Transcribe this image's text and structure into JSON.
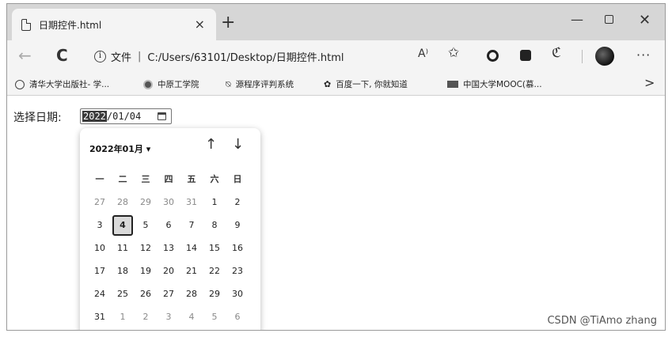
{
  "tab": {
    "title": "日期控件.html",
    "close": "×",
    "new_tab": "+"
  },
  "window_controls": {
    "minimize": "—",
    "close": "✕"
  },
  "toolbar": {
    "back": "←",
    "reload": "C",
    "file_label": "文件",
    "separator": "|",
    "url": "C:/Users/63101/Desktop/日期控件.html",
    "read_aloud": "A⁾",
    "favorite": "✩",
    "more": "···"
  },
  "bookmarks": [
    {
      "label": "清华大学出版社- 学...",
      "icon": "circle-icon"
    },
    {
      "label": "中原工学院",
      "icon": "dot-icon"
    },
    {
      "label": "源程序评判系统",
      "icon": "clip-icon"
    },
    {
      "label": "百度一下, 你就知道",
      "icon": "paw-icon"
    },
    {
      "label": "中国大学MOOC(慕...",
      "icon": "book-icon"
    }
  ],
  "bookmarks_more": ">",
  "form": {
    "label": "选择日期:",
    "value_year": "2022",
    "value_rest": "/01/04"
  },
  "calendar": {
    "month_label": "2022年01月 ▾",
    "nav_up": "↑",
    "nav_down": "↓",
    "weekdays": [
      "一",
      "二",
      "三",
      "四",
      "五",
      "六",
      "日"
    ],
    "weeks": [
      [
        "27",
        "28",
        "29",
        "30",
        "31",
        "1",
        "2"
      ],
      [
        "3",
        "4",
        "5",
        "6",
        "7",
        "8",
        "9"
      ],
      [
        "10",
        "11",
        "12",
        "13",
        "14",
        "15",
        "16"
      ],
      [
        "17",
        "18",
        "19",
        "20",
        "21",
        "22",
        "23"
      ],
      [
        "24",
        "25",
        "26",
        "27",
        "28",
        "29",
        "30"
      ],
      [
        "31",
        "1",
        "2",
        "3",
        "4",
        "5",
        "6"
      ]
    ],
    "selected": "4"
  },
  "watermark": "CSDN @TiAmo zhang"
}
